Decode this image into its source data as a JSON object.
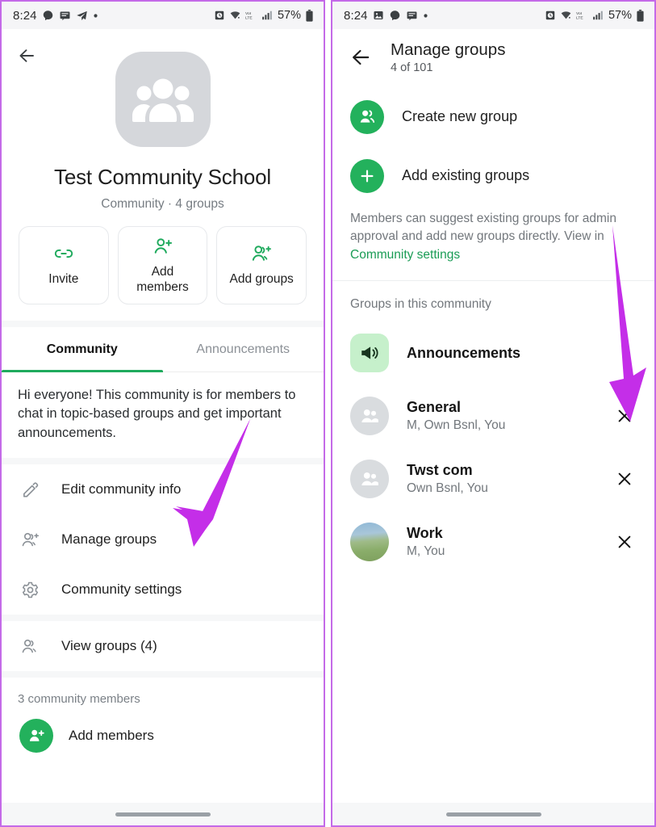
{
  "accent": {
    "green": "#23b15c",
    "green_text": "#1a9c55",
    "arrow_purple": "#c42ee8",
    "frame_purple": "#c46ae8"
  },
  "left_panel": {
    "status_bar": {
      "time": "8:24",
      "icons_left": [
        "chat-bubble-icon",
        "message-icon",
        "send-icon",
        "dot-icon"
      ],
      "icons_right": [
        "alarm-icon",
        "wifi-icon",
        "volte-icon",
        "signal-icon"
      ],
      "battery": "57%"
    },
    "back_icon": "back-arrow-icon",
    "community": {
      "avatar_icon": "community-group-icon",
      "title": "Test Community School",
      "subtitle": "Community · 4 groups"
    },
    "actions": [
      {
        "icon": "link-icon",
        "label": "Invite"
      },
      {
        "icon": "person-add-icon",
        "label": "Add members"
      },
      {
        "icon": "group-add-icon",
        "label": "Add groups"
      }
    ],
    "tabs": [
      {
        "label": "Community",
        "active": true
      },
      {
        "label": "Announcements",
        "active": false
      }
    ],
    "description": "Hi everyone! This community is for members to chat in topic-based groups and get important announcements.",
    "menu": [
      {
        "icon": "pencil-icon",
        "label": "Edit community info"
      },
      {
        "icon": "group-add-icon",
        "label": "Manage groups"
      },
      {
        "icon": "gear-icon",
        "label": "Community settings"
      }
    ],
    "menu2": [
      {
        "icon": "group-icon",
        "label": "View groups (4)"
      }
    ],
    "members_caption": "3 community members",
    "add_members_label": "Add members"
  },
  "right_panel": {
    "status_bar": {
      "time": "8:24",
      "icons_left": [
        "image-icon",
        "chat-bubble-icon",
        "message-icon",
        "dot-icon"
      ],
      "icons_right": [
        "alarm-icon",
        "wifi-icon",
        "volte-icon",
        "signal-icon"
      ],
      "battery": "57%"
    },
    "back_icon": "back-arrow-icon",
    "header": {
      "title": "Manage groups",
      "subtitle": "4 of 101"
    },
    "actions": [
      {
        "icon": "group-icon",
        "label": "Create new group"
      },
      {
        "icon": "plus-icon",
        "label": "Add existing groups"
      }
    ],
    "note": {
      "text": "Members can suggest existing groups for admin approval and add new groups directly. View in ",
      "link": "Community settings"
    },
    "groups_caption": "Groups in this community",
    "groups": [
      {
        "avatar": "announcements-megaphone-icon",
        "avatar_type": "announcement",
        "name": "Announcements",
        "subtitle": "",
        "removable": false
      },
      {
        "avatar": "group-placeholder-icon",
        "avatar_type": "generic",
        "name": "General",
        "subtitle": "M, Own Bsnl, You",
        "removable": true
      },
      {
        "avatar": "group-placeholder-icon",
        "avatar_type": "generic",
        "name": "Twst com",
        "subtitle": "Own Bsnl, You",
        "removable": true
      },
      {
        "avatar": "landscape-photo",
        "avatar_type": "photo",
        "name": "Work",
        "subtitle": "M, You",
        "removable": true
      }
    ]
  },
  "annotations": [
    {
      "name": "arrow-to-manage-groups",
      "target": "Manage groups"
    },
    {
      "name": "arrow-to-remove-general",
      "target": "General remove button"
    }
  ]
}
